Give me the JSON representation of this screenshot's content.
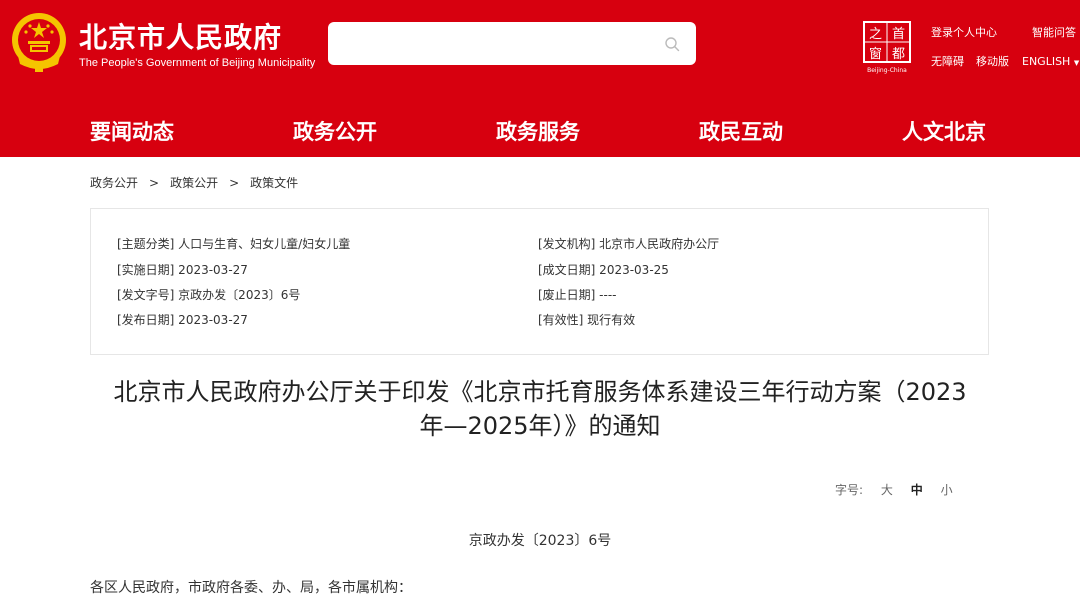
{
  "header": {
    "title_cn": "北京市人民政府",
    "title_en": "The People's Government of Beijing Municipality",
    "bg_color": "#d7000f",
    "search": {
      "placeholder": ""
    },
    "capital_logo": {
      "chars": [
        "之",
        "首",
        "窗",
        "都"
      ],
      "caption": "Beijing-China"
    },
    "links": {
      "login": "登录个人中心",
      "smart_qa": "智能问答",
      "accessible": "无障碍",
      "mobile": "移动版",
      "english": "ENGLISH"
    }
  },
  "nav": {
    "items": [
      "要闻动态",
      "政务公开",
      "政务服务",
      "政民互动",
      "人文北京"
    ]
  },
  "breadcrumb": {
    "items": [
      "政务公开",
      "政策公开",
      "政策文件"
    ],
    "separator": ">"
  },
  "meta": {
    "topic": "[主题分类] 人口与生育、妇女儿童/妇女儿童",
    "issuer": "[发文机构] 北京市人民政府办公厅",
    "effective_date": "[实施日期] 2023-03-27",
    "written_date": "[成文日期] 2023-03-25",
    "doc_code": "[发文字号] 京政办发〔2023〕6号",
    "repeal_date": "[废止日期] ----",
    "publish_date": "[发布日期] 2023-03-27",
    "validity": "[有效性] 现行有效"
  },
  "document": {
    "title_line1": "北京市人民政府办公厅关于印发《北京市托育服务体系建设三年行动方案（2023",
    "title_line2": "年—2025年）》的通知",
    "font_size_label": "字号:",
    "font_sizes": [
      "大",
      "中",
      "小"
    ],
    "number": "京政办发〔2023〕6号",
    "recipients": "各区人民政府，市政府各委、办、局，各市属机构："
  }
}
